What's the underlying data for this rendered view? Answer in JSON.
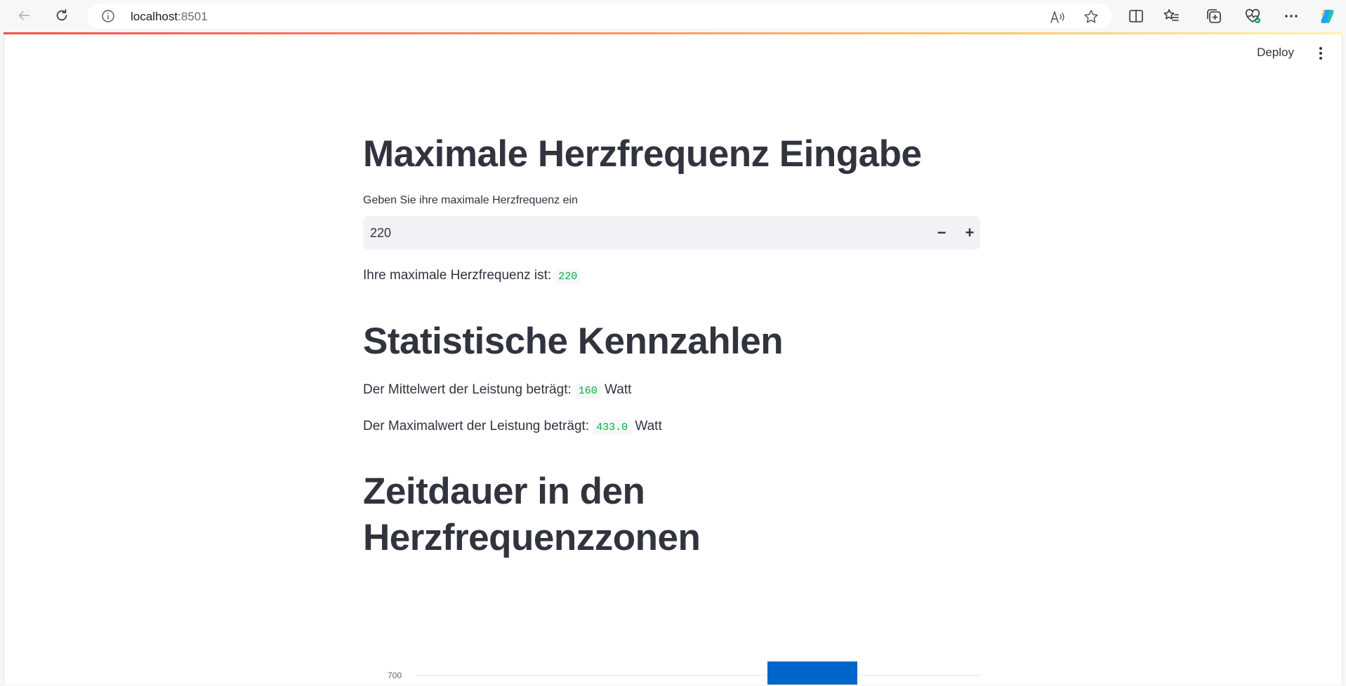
{
  "browser": {
    "url_host": "localhost",
    "url_port": ":8501"
  },
  "header": {
    "deploy_label": "Deploy"
  },
  "section1": {
    "title": "Maximale Herzfrequenz Eingabe",
    "input_label": "Geben Sie ihre maximale Herzfrequenz ein",
    "input_value": "220",
    "result_text": "Ihre maximale Herzfrequenz ist:",
    "result_value": "220"
  },
  "section2": {
    "title": "Statistische Kennzahlen",
    "mean_text": "Der Mittelwert der Leistung beträgt:",
    "mean_value": "160",
    "mean_unit": "Watt",
    "max_text": "Der Maximalwert der Leistung beträgt:",
    "max_value": "433.0",
    "max_unit": "Watt"
  },
  "section3": {
    "title": "Zeitdauer in den Herzfrequenzzonen"
  },
  "chart_data": {
    "type": "bar",
    "y_tick_labels": [
      "700"
    ],
    "visible_bars": [
      {
        "value_min": 720
      }
    ],
    "color": "#0066cc",
    "grid": true
  }
}
